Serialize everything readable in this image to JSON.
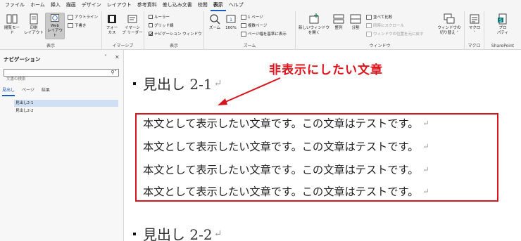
{
  "menu": {
    "items": [
      "ファイル",
      "ホーム",
      "挿入",
      "描画",
      "デザイン",
      "レイアウト",
      "参考資料",
      "差し込み文書",
      "校閲",
      "表示",
      "ヘルプ"
    ],
    "active": "表示"
  },
  "ribbon": {
    "views": {
      "read_mode": "閲覧モード",
      "print_layout": "印刷\nレイアウト",
      "web_layout": "Web\nレイアウト",
      "outline": "アウトライン",
      "draft": "下書き",
      "label": "表示"
    },
    "immersive": {
      "focus": "フォー\nカス",
      "immersive_reader": "イマーシ\nブ リーダー",
      "label": "イマーシブ"
    },
    "show": {
      "ruler": "ルーラー",
      "gridlines": "グリッド線",
      "nav_pane": "ナビゲーション ウィンドウ",
      "label": "表示"
    },
    "zoom": {
      "zoom": "ズーム",
      "hundred": "100%",
      "one_page": "1 ページ",
      "multi_page": "複数ページ",
      "page_width": "ページ幅を基準に表示",
      "label": "ズーム"
    },
    "window": {
      "new_window": "新しいウィンドウ\nを開く",
      "arrange": "整列",
      "split": "分割",
      "side_by_side": "並べて比較",
      "sync_scroll": "同時にスクロール",
      "reset_pos": "ウィンドウの位置を元に戻す",
      "switch": "ウィンドウの\n切り替え ˅",
      "label": "ウィンドウ"
    },
    "macro": {
      "macro": "マクロ\n˅",
      "label": "マクロ"
    },
    "sharepoint": {
      "props": "プロ\nパティ",
      "label": "SharePoint"
    }
  },
  "nav": {
    "title": "ナビゲーション",
    "search_placeholder": "文書の検索",
    "tabs": [
      "見出し",
      "ページ",
      "結果"
    ],
    "items": [
      "見出し2-1",
      "見出し2-2"
    ]
  },
  "doc": {
    "heading1": "見出し 2-1",
    "heading2": "見出し 2-2",
    "paragraph_mark": "↵",
    "body_lines": [
      "本文として表示したい文章です。この文章はテストです。",
      "本文として表示したい文章です。この文章はテストです。",
      "本文として表示したい文章です。この文章はテストです。",
      "本文として表示したい文章です。この文章はテストです。"
    ],
    "annotation": "非表示にしたい文章",
    "annotation_color": "#e0141d"
  }
}
